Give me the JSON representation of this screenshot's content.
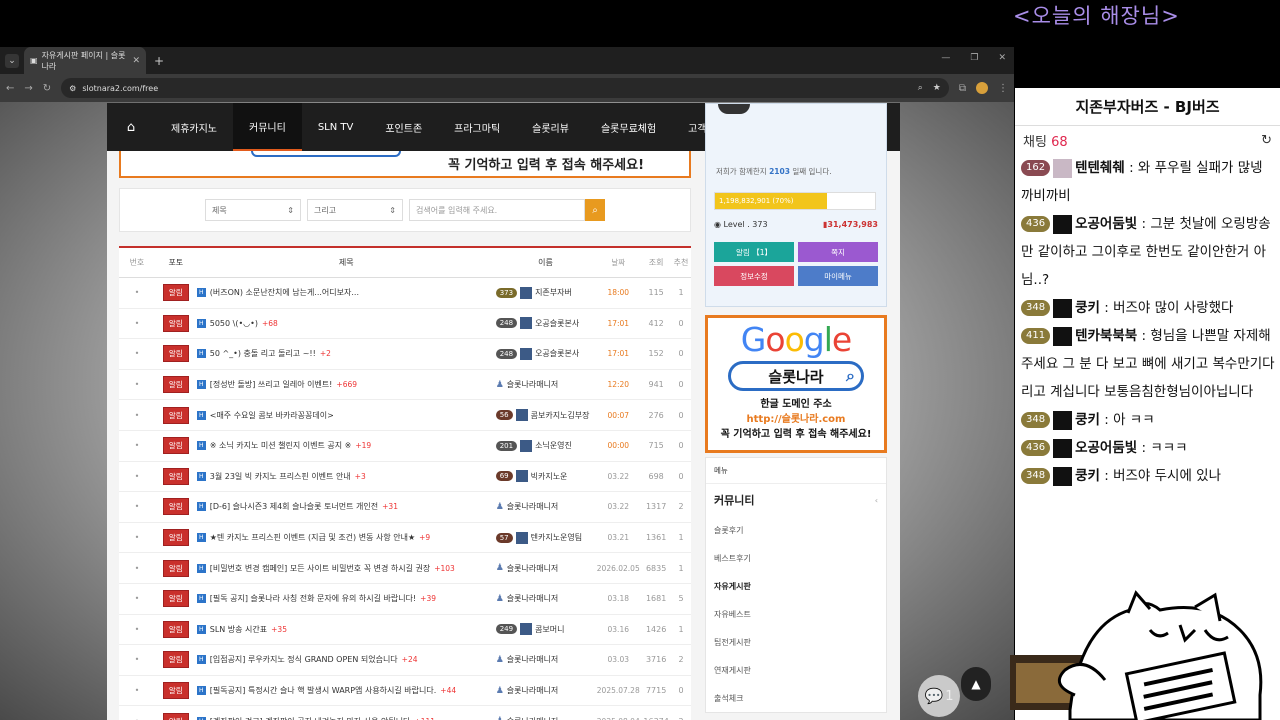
{
  "stream": {
    "title": "<오늘의 해장님>"
  },
  "browser": {
    "tab_title": "자유게시판 페이지 | 슬롯나라",
    "url": "slotnara2.com/free"
  },
  "nav": {
    "items": [
      "제휴카지노",
      "커뮤니티",
      "SLN TV",
      "포인트존",
      "프라그마틱",
      "슬롯리뷰",
      "슬롯무료체험",
      "고객센터"
    ],
    "active": "커뮤니티",
    "badge": "1"
  },
  "banner": {
    "text": "꼭 기억하고 입력 후 접속 해주세요!"
  },
  "search": {
    "field1": "제목",
    "field2": "그리고",
    "placeholder": "검색어를 입력해 주세요."
  },
  "table": {
    "headers": [
      "번호",
      "포토",
      "제목",
      "이름",
      "날짜",
      "조회",
      "추천"
    ],
    "rows": [
      {
        "tag": "알림",
        "title": "(버즈ON) 소문난잔치에 남는게...어디보자...",
        "count": "",
        "lv": "373",
        "name": "지존부자버",
        "date": "18:00",
        "views": "115",
        "rec": "1"
      },
      {
        "tag": "알림",
        "title": "5050  \\(•◡•)",
        "count": "+68",
        "lv": "248",
        "name": "오공슬롯본사",
        "date": "17:01",
        "views": "412",
        "rec": "0"
      },
      {
        "tag": "알림",
        "title": "50 ^_•) 충돌 리고 돌리고 ~!!",
        "count": "+2",
        "lv": "248",
        "name": "오공슬롯본사",
        "date": "17:01",
        "views": "152",
        "rec": "0"
      },
      {
        "tag": "알림",
        "title": "[정성반 돌방] 쓰리고 일레아 이벤트!",
        "count": "+669",
        "lv": "",
        "name": "슬롯나라매니저",
        "date": "12:20",
        "views": "941",
        "rec": "0"
      },
      {
        "tag": "알림",
        "title": "<매주 수요일 콤보 바카라꽁꽁데이>",
        "count": "",
        "lv": "56",
        "name": "콤보카지노김부장",
        "date": "00:07",
        "views": "276",
        "rec": "0"
      },
      {
        "tag": "알림",
        "title": "※ 소닉 카지노 미션 챌린지 이벤트 공지 ※",
        "count": "+19",
        "lv": "201",
        "name": "소닉운영진",
        "date": "00:00",
        "views": "715",
        "rec": "0"
      },
      {
        "tag": "알림",
        "title": "3월 23일 빅 카지노 프리스핀 이벤트 안내",
        "count": "+3",
        "lv": "69",
        "name": "빅카지노운",
        "date": "03.22",
        "views": "698",
        "rec": "0"
      },
      {
        "tag": "알림",
        "title": "[D-6] 슬나시즌3 제4회 슬나슬롯 토너먼트 개인전",
        "count": "+31",
        "lv": "",
        "name": "슬롯나라매니저",
        "date": "03.22",
        "views": "1317",
        "rec": "2"
      },
      {
        "tag": "알림",
        "title": "★텐 카지노 프리스핀 이벤트 (지급 및 조건) 변동 사항 안내★",
        "count": "+9",
        "lv": "57",
        "name": "텐카지노운영팀",
        "date": "03.21",
        "views": "1361",
        "rec": "1"
      },
      {
        "tag": "알림",
        "title": "[비밀번호 변경 캠페인] 모든 사이트 비밀번호 꼭 변경 하시길 권장",
        "count": "+103",
        "lv": "",
        "name": "슬롯나라매니저",
        "date": "2026.02.05",
        "views": "6835",
        "rec": "1"
      },
      {
        "tag": "알림",
        "title": "[필독 공지] 슬롯나라 사칭 전화 문자에 유의 하시길 바랍니다!",
        "count": "+39",
        "lv": "",
        "name": "슬롯나라매니저",
        "date": "03.18",
        "views": "1681",
        "rec": "5"
      },
      {
        "tag": "알림",
        "title": "SLN 방송 시간표",
        "count": "+35",
        "lv": "249",
        "name": "콤보머니",
        "date": "03.16",
        "views": "1426",
        "rec": "1"
      },
      {
        "tag": "알림",
        "title": "[입점공지] 루우카지노 정식 GRAND OPEN 되었습니다",
        "count": "+24",
        "lv": "",
        "name": "슬롯나라매니저",
        "date": "03.03",
        "views": "3716",
        "rec": "2"
      },
      {
        "tag": "알림",
        "title": "[필독공지] 특정시간 슬나 핵 발생시 WARP앱 사용하시길 바랍니다.",
        "count": "+44",
        "lv": "",
        "name": "슬롯나라매니저",
        "date": "2025.07.28",
        "views": "7715",
        "rec": "0"
      },
      {
        "tag": "알림",
        "title": "[계좌팔이 경고] 계좌팔이 공지 내려놓지 마자 사용 안됩니다",
        "count": "+111",
        "lv": "",
        "name": "슬롯나라매니저",
        "date": "2025.08.04",
        "views": "16374",
        "rec": "2"
      }
    ]
  },
  "profile": {
    "joined_prefix": "저희가 함께한지 ",
    "joined_days": "2103",
    "joined_suffix": " 일째 입니다.",
    "xp_text": "1,198,832,901 (70%)",
    "xp_fraction": 0.7,
    "level": "Level . 373",
    "points": "31,473,983",
    "buttons": [
      "알림 【1】",
      "쪽지",
      "정보수정",
      "마이메뉴"
    ]
  },
  "ad": {
    "logo": "Google",
    "search_text": "슬롯나라",
    "line1": "한글 도메인 주소",
    "url": "http://슬롯나라.com",
    "line2": "꼭 기억하고 입력 후 접속 해주세요!"
  },
  "menu": {
    "header": "메뉴",
    "group": "커뮤니티",
    "items": [
      "슬롯후기",
      "베스트후기",
      "자유게시판",
      "자유베스트",
      "팁전게시판",
      "연재게시판",
      "출석체크"
    ],
    "current": "자유게시판"
  },
  "floating": {
    "chat_count": "1"
  },
  "chat": {
    "title": "지존부자버즈 - BJ버즈",
    "label": "채팅",
    "count": "68",
    "messages": [
      {
        "lv": "162",
        "name": "텐텐췌췌",
        "text": " : 와 푸우릴 실패가 많넹 까비까비",
        "style": "r"
      },
      {
        "lv": "436",
        "name": "오공어둠빛",
        "text": " : 그분 첫날에 오링방송만 같이하고 그이후로 한번도 같이안한거 아님..?",
        "style": ""
      },
      {
        "lv": "348",
        "name": "쿵키",
        "text": " : 버즈야 많이 사랑했다",
        "style": ""
      },
      {
        "lv": "411",
        "name": "텐카북북북",
        "text": " : 형님을 나쁜말 자제해주세요 그 분 다 보고 뼈에 새기고 복수만기다리고 계십니다 보통음침한형님이아닙니다",
        "style": ""
      },
      {
        "lv": "348",
        "name": "쿵키",
        "text": " : 아 ㅋㅋ",
        "style": ""
      },
      {
        "lv": "436",
        "name": "오공어둠빛",
        "text": " : ㅋㅋㅋ",
        "style": ""
      },
      {
        "lv": "348",
        "name": "쿵키",
        "text": " : 버즈야 두시에 있나",
        "style": ""
      }
    ]
  },
  "colors": {
    "accent": "#e25b1c",
    "notice": "#c9302c",
    "chat_count": "#e0284f"
  }
}
